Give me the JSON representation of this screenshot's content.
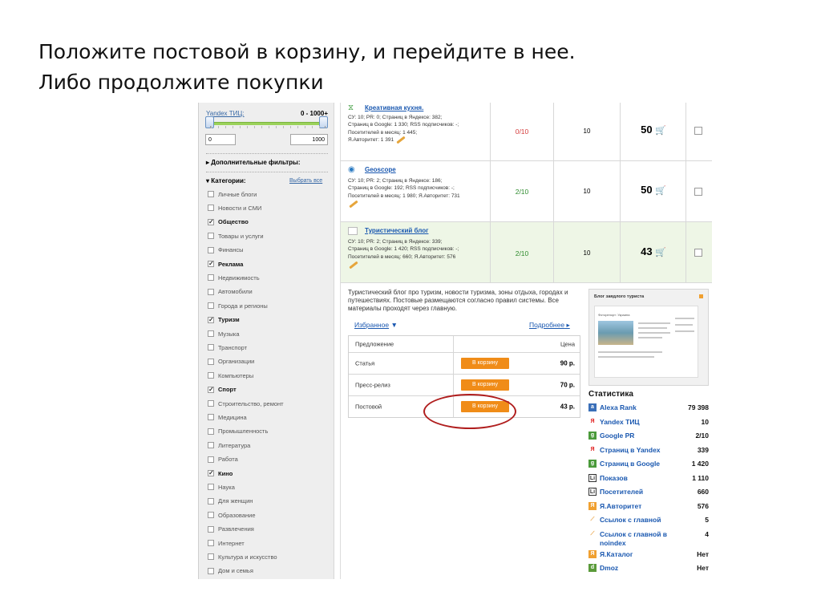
{
  "slide": {
    "line1": "Положите постовой в корзину, и перейдите в нее.",
    "line2": "Либо продолжите покупки"
  },
  "sidebar": {
    "tic_label": "Yandex ТИЦ:",
    "tic_range": "0 - 1000+",
    "min_value": "0",
    "max_value": "1000",
    "extra_filters": "Дополнительные фильтры:",
    "categories_label": "Категории:",
    "select_all": "Выбрать все",
    "categories": [
      {
        "label": "Личные блоги",
        "checked": false
      },
      {
        "label": "Новости и СМИ",
        "checked": false
      },
      {
        "label": "Общество",
        "checked": true
      },
      {
        "label": "Товары и услуги",
        "checked": false
      },
      {
        "label": "Финансы",
        "checked": false
      },
      {
        "label": "Реклама",
        "checked": true
      },
      {
        "label": "Недвижимость",
        "checked": false
      },
      {
        "label": "Автомобили",
        "checked": false
      },
      {
        "label": "Города и регионы",
        "checked": false
      },
      {
        "label": "Туризм",
        "checked": true
      },
      {
        "label": "Музыка",
        "checked": false
      },
      {
        "label": "Транспорт",
        "checked": false
      },
      {
        "label": "Организации",
        "checked": false
      },
      {
        "label": "Компьютеры",
        "checked": false
      },
      {
        "label": "Спорт",
        "checked": true
      },
      {
        "label": "Строительство, ремонт",
        "checked": false
      },
      {
        "label": "Медицина",
        "checked": false
      },
      {
        "label": "Промышленность",
        "checked": false
      },
      {
        "label": "Литература",
        "checked": false
      },
      {
        "label": "Работа",
        "checked": false
      },
      {
        "label": "Кино",
        "checked": true
      },
      {
        "label": "Наука",
        "checked": false
      },
      {
        "label": "Для женщин",
        "checked": false
      },
      {
        "label": "Образование",
        "checked": false
      },
      {
        "label": "Развлечения",
        "checked": false
      },
      {
        "label": "Интернет",
        "checked": false
      },
      {
        "label": "Культура и искусство",
        "checked": false
      },
      {
        "label": "Дом и семья",
        "checked": false
      }
    ]
  },
  "sites": [
    {
      "name": "Креативная кухня.",
      "meta1": "СУ: 10; PR: 0; Страниц в Яндексе: 382;",
      "meta2": "Страниц в Google: 1 330; RSS подписчиков: -;",
      "meta3": "Посетителей в месяц: 1 445;",
      "meta4": "Я.Авторитет: 1 391",
      "pr": "0/10",
      "tic": "10",
      "price": "50"
    },
    {
      "name": "Geoscope",
      "meta1": "СУ: 10; PR: 2; Страниц в Яндексе: 186;",
      "meta2": "Страниц в Google: 192; RSS подписчиков: -;",
      "meta3": "Посетителей в месяц: 1 980; Я.Авторитет: 731",
      "meta4": "",
      "pr": "2/10",
      "tic": "10",
      "price": "50"
    },
    {
      "name": "Туристический блог",
      "meta1": "СУ: 10; PR: 2; Страниц в Яндексе: 339;",
      "meta2": "Страниц в Google: 1 420; RSS подписчиков: -;",
      "meta3": "Посетителей в месяц: 660; Я.Авторитет: 576",
      "meta4": "",
      "pr": "2/10",
      "tic": "10",
      "price": "43"
    }
  ],
  "details": {
    "description": "Туристический блог про туризм, новости туризма, зоны отдыха, городах и путешествиях. Постовые размещаются согласно правил системы. Все материалы проходят через главную.",
    "favorite": "Избранное",
    "more": "Подробнее",
    "offer_header": "Предложение",
    "price_header": "Цена",
    "offers": [
      {
        "name": "Статья",
        "button": "В корзину",
        "price": "90 р."
      },
      {
        "name": "Пресс-релиз",
        "button": "В корзину",
        "price": "70 р."
      },
      {
        "name": "Постовой",
        "button": "В корзину",
        "price": "43 р."
      }
    ],
    "preview_title": "Блог заядлого туриста",
    "preview_heading": "Фоторепорт: Украина"
  },
  "stats": {
    "title": "Статистика",
    "items": [
      {
        "label": "Alexa Rank",
        "value": "79 398",
        "icon": "alexa-icon"
      },
      {
        "label": "Yandex ТИЦ",
        "value": "10",
        "icon": "yandex-icon"
      },
      {
        "label": "Google PR",
        "value": "2/10",
        "icon": "google-icon"
      },
      {
        "label": "Страниц в Yandex",
        "value": "339",
        "icon": "yandex-icon"
      },
      {
        "label": "Страниц в Google",
        "value": "1 420",
        "icon": "google-icon"
      },
      {
        "label": "Показов",
        "value": "1 110",
        "icon": "liveinternet-icon"
      },
      {
        "label": "Посетителей",
        "value": "660",
        "icon": "liveinternet-icon"
      },
      {
        "label": "Я.Авторитет",
        "value": "576",
        "icon": "yandex-authority-icon"
      },
      {
        "label": "Ссылок с главной",
        "value": "5",
        "icon": "feather-icon"
      },
      {
        "label": "Ссылок с главной в noindex",
        "value": "4",
        "icon": "feather-icon"
      },
      {
        "label": "Я.Каталог",
        "value": "Нет",
        "icon": "yandex-authority-icon"
      },
      {
        "label": "Dmoz",
        "value": "Нет",
        "icon": "dmoz-icon"
      }
    ]
  }
}
